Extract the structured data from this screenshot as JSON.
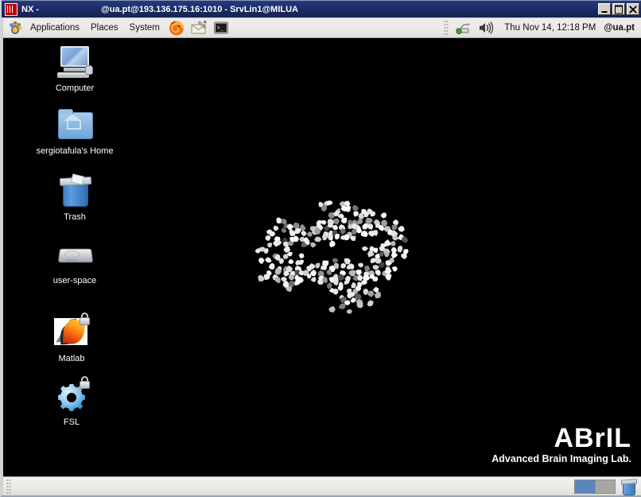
{
  "window": {
    "app_label": "NX -",
    "session_title": "@ua.pt@193.136.175.16:1010 - SrvLin1@MILUA",
    "logo_icon": "nx-logo-icon",
    "minimize_icon": "minimize-icon",
    "maximize_icon": "maximize-icon",
    "close_icon": "close-icon",
    "titlebar_color": "#1b2b68"
  },
  "top_panel": {
    "menus": [
      {
        "label": "Applications"
      },
      {
        "label": "Places"
      },
      {
        "label": "System"
      }
    ],
    "foot_icon": "gnome-foot-icon",
    "launchers": [
      {
        "icon": "firefox-icon"
      },
      {
        "icon": "evolution-mail-icon"
      },
      {
        "icon": "terminal-icon"
      }
    ],
    "tray": [
      {
        "icon": "network-icon"
      },
      {
        "icon": "volume-icon"
      }
    ],
    "clock": "Thu Nov 14, 12:18 PM",
    "user": "@ua.pt"
  },
  "desktop": {
    "background_color": "#000000",
    "icons": [
      {
        "label": "Computer",
        "icon": "computer-icon",
        "locked": false
      },
      {
        "label": "sergiotafula's Home",
        "icon": "home-folder-icon",
        "locked": false
      },
      {
        "label": "Trash",
        "icon": "trash-icon",
        "locked": false
      },
      {
        "label": "user-space",
        "icon": "hard-drive-icon",
        "locked": false
      },
      {
        "label": "Matlab",
        "icon": "matlab-icon",
        "locked": true
      },
      {
        "label": "FSL",
        "icon": "fsl-gear-icon",
        "locked": true
      }
    ],
    "wallpaper": {
      "artwork": "brain-mosaic-sagittal",
      "logo_title": "ABrIL",
      "logo_subtitle": "Advanced Brain Imaging Lab."
    }
  },
  "bottom_panel": {
    "workspaces": [
      {
        "active": true
      },
      {
        "active": false
      }
    ],
    "trash_applet_icon": "trash-applet-icon",
    "active_workspace_color": "#5a85bd"
  }
}
